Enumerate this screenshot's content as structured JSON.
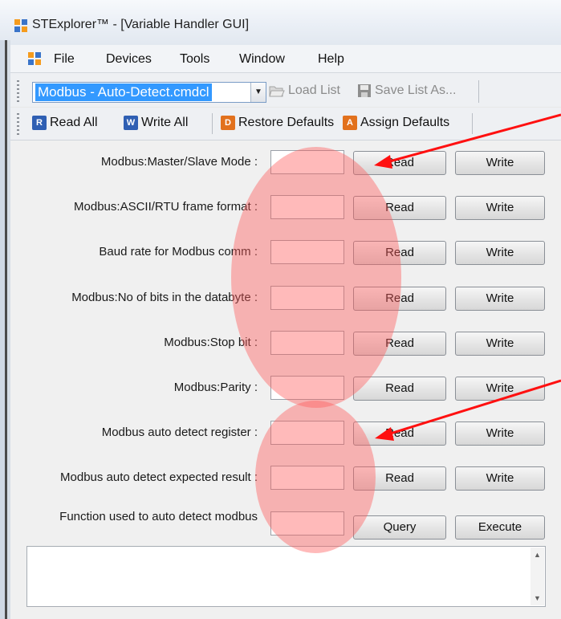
{
  "window": {
    "title": "STExplorer™ - [Variable Handler GUI]"
  },
  "menu": {
    "items": [
      "File",
      "Devices",
      "Tools",
      "Window",
      "Help"
    ]
  },
  "toolbar1": {
    "selected_list": "Modbus - Auto-Detect.cmdcl",
    "load_list": "Load List",
    "save_list": "Save List As..."
  },
  "toolbar2": {
    "read_all": "Read All",
    "write_all": "Write All",
    "restore_defaults": "Restore Defaults",
    "assign_defaults": "Assign Defaults"
  },
  "variables": [
    {
      "label": "Modbus:Master/Slave Mode :",
      "value": "",
      "btn1": "Read",
      "btn2": "Write"
    },
    {
      "label": "Modbus:ASCII/RTU frame format :",
      "value": "",
      "btn1": "Read",
      "btn2": "Write"
    },
    {
      "label": "Baud rate for Modbus comm :",
      "value": "",
      "btn1": "Read",
      "btn2": "Write"
    },
    {
      "label": "Modbus:No of bits in the databyte :",
      "value": "",
      "btn1": "Read",
      "btn2": "Write"
    },
    {
      "label": "Modbus:Stop bit :",
      "value": "",
      "btn1": "Read",
      "btn2": "Write"
    },
    {
      "label": "Modbus:Parity :",
      "value": "",
      "btn1": "Read",
      "btn2": "Write"
    },
    {
      "label": "Modbus auto detect register :",
      "value": "",
      "btn1": "Read",
      "btn2": "Write"
    },
    {
      "label": "Modbus auto detect expected result :",
      "value": "",
      "btn1": "Read",
      "btn2": "Write"
    },
    {
      "label": "Function used to auto detect modbus",
      "value": "",
      "btn1": "Query",
      "btn2": "Execute"
    }
  ],
  "output": {
    "text": ""
  },
  "annotation": {
    "highlight_color": "#ff5a5a",
    "arrow_color": "#ff1010"
  },
  "icons": {
    "app": "app-window-icon",
    "load": "folder-open-icon",
    "save": "floppy-disk-icon",
    "read_all": "read-all-icon",
    "write_all": "write-all-icon",
    "restore": "restore-defaults-icon",
    "assign": "assign-defaults-icon"
  }
}
